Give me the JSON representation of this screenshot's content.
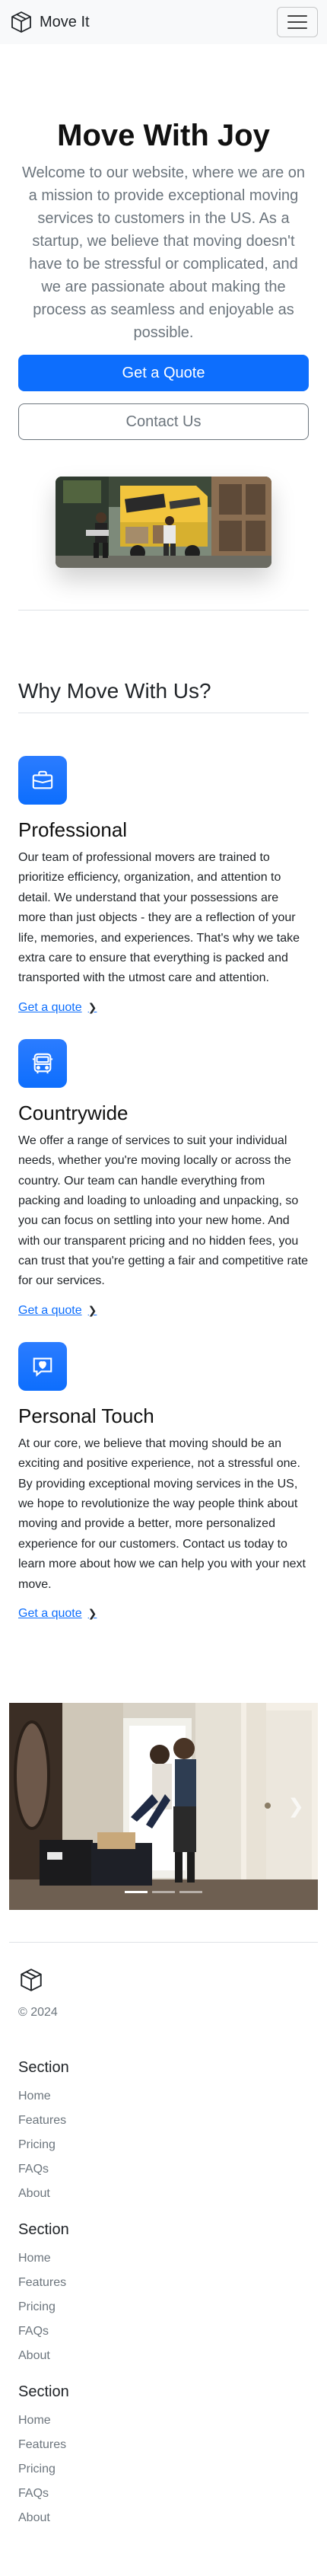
{
  "navbar": {
    "brand": "Move It",
    "toggle_icon": "hamburger-menu-icon"
  },
  "hero": {
    "title": "Move With Joy",
    "lead": "Welcome to our website, where we are on a mission to provide exceptional moving services to customers in the US. As a startup, we believe that moving doesn't have to be stressful or complicated, and we are passionate about making the process as seamless and enjoyable as possible.",
    "primary_button": "Get a Quote",
    "secondary_button": "Contact Us"
  },
  "features": {
    "heading": "Why Move With Us?",
    "items": [
      {
        "icon": "briefcase-icon",
        "title": "Professional",
        "text": "Our team of professional movers are trained to prioritize efficiency, organization, and attention to detail. We understand that your possessions are more than just objects - they are a reflection of your life, memories, and experiences. That's why we take extra care to ensure that everything is packed and transported with the utmost care and attention.",
        "link": "Get a quote"
      },
      {
        "icon": "bus-icon",
        "title": "Countrywide",
        "text": "We offer a range of services to suit your individual needs, whether you're moving locally or across the country. Our team can handle everything from packing and loading to unloading and unpacking, so you can focus on settling into your new home. And with our transparent pricing and no hidden fees, you can trust that you're getting a fair and competitive rate for our services.",
        "link": "Get a quote"
      },
      {
        "icon": "chat-heart-icon",
        "title": "Personal Touch",
        "text": "At our core, we believe that moving should be an exciting and positive experience, not a stressful one. By providing exceptional moving services in the US, we hope to revolutionize the way people think about moving and provide a better, more personalized experience for our customers. Contact us today to learn more about how we can help you with your next move.",
        "link": "Get a quote"
      }
    ]
  },
  "carousel": {
    "next_icon": "chevron-right-icon",
    "slide_count": 3,
    "active_slide": 1
  },
  "footer": {
    "logo_icon": "box-icon",
    "copyright": "© 2024",
    "sections": [
      {
        "title": "Section",
        "links": [
          "Home",
          "Features",
          "Pricing",
          "FAQs",
          "About"
        ]
      },
      {
        "title": "Section",
        "links": [
          "Home",
          "Features",
          "Pricing",
          "FAQs",
          "About"
        ]
      },
      {
        "title": "Section",
        "links": [
          "Home",
          "Features",
          "Pricing",
          "FAQs",
          "About"
        ]
      }
    ]
  },
  "colors": {
    "primary": "#0d6efd",
    "muted": "#6c757d",
    "navbar_bg": "#f8f9fa"
  }
}
